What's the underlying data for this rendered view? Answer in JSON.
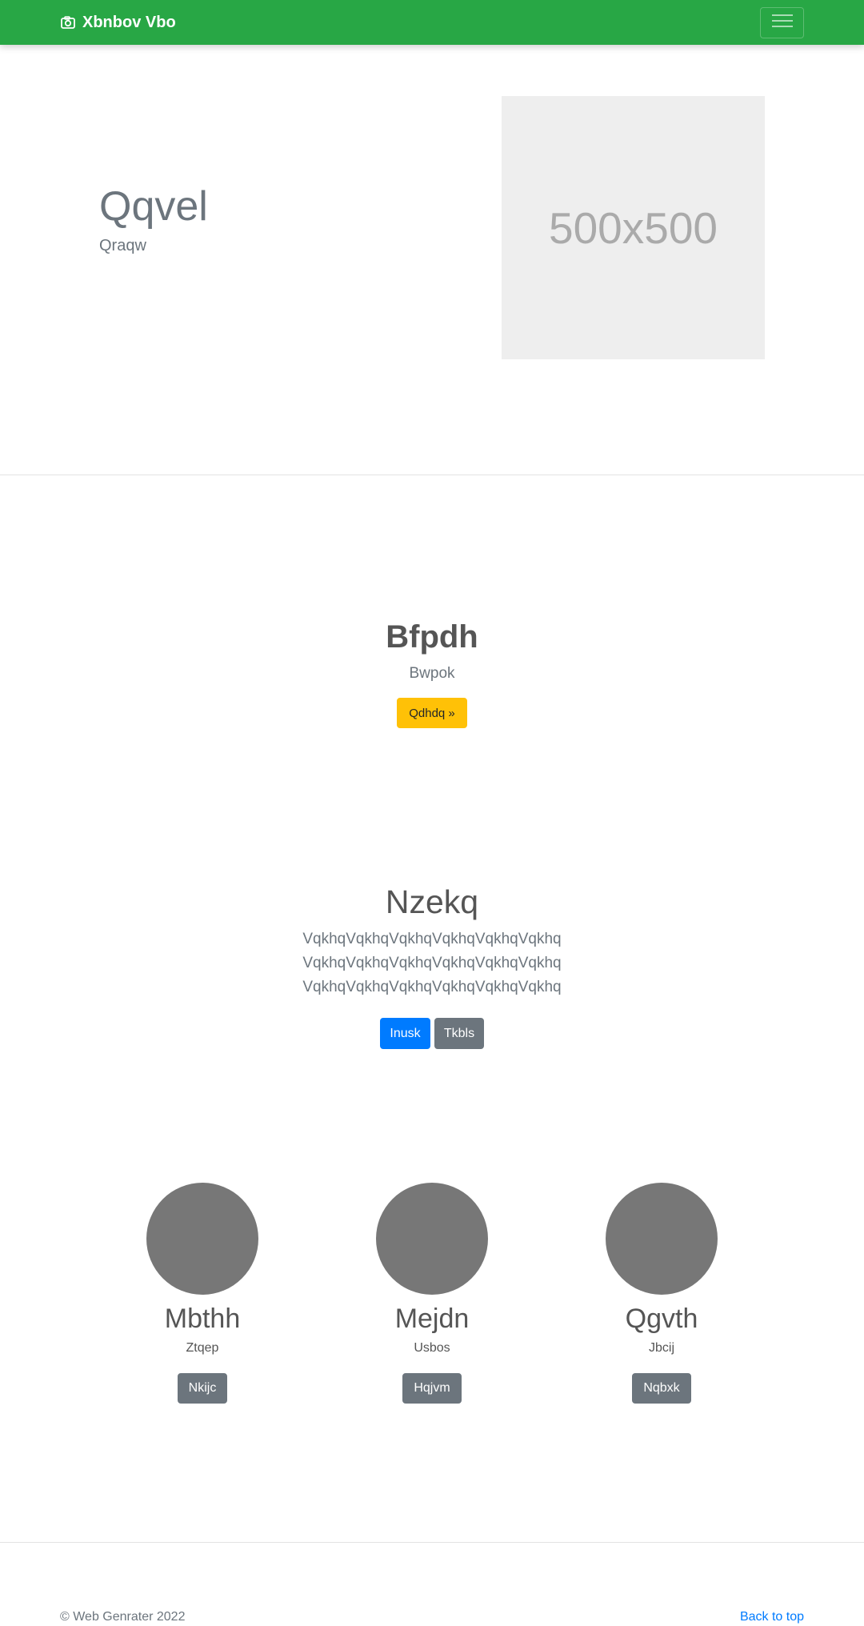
{
  "navbar": {
    "brand": "Xbnbov Vbo",
    "brand_icon": "camera-icon",
    "toggler_icon": "hamburger-menu-icon",
    "color": "#28a745"
  },
  "hero": {
    "title": "Qqvel",
    "subtitle": "Qraqw",
    "image_placeholder": "500x500"
  },
  "section2": {
    "title": "Bfpdh",
    "subtitle": "Bwpok",
    "button": "Qdhdq »"
  },
  "section3": {
    "title": "Nzekq",
    "lines": [
      "VqkhqVqkhqVqkhqVqkhqVqkhqVqkhq",
      "VqkhqVqkhqVqkhqVqkhqVqkhqVqkhq",
      "VqkhqVqkhqVqkhqVqkhqVqkhqVqkhq"
    ],
    "primary_button": "Inusk",
    "secondary_button": "Tkbls"
  },
  "columns": [
    {
      "title": "Mbthh",
      "subtitle": "Ztqep",
      "button": "Nkijc"
    },
    {
      "title": "Mejdn",
      "subtitle": "Usbos",
      "button": "Hqjvm"
    },
    {
      "title": "Qgvth",
      "subtitle": "Jbcij",
      "button": "Nqbxk"
    }
  ],
  "footer": {
    "copyright": "© Web Genrater 2022",
    "back_to_top": "Back to top"
  }
}
